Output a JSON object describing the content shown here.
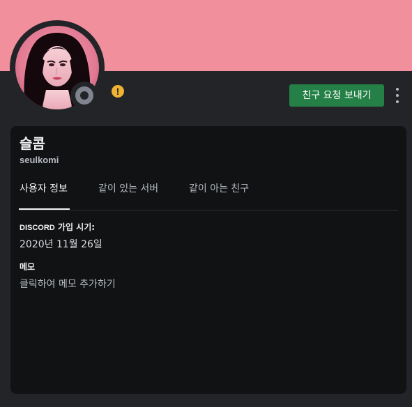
{
  "profile": {
    "display_name": "슬콤",
    "username": "seulkomi",
    "banner_color": "#f28f9c",
    "status": "offline",
    "warning_badge_glyph": "!"
  },
  "actions": {
    "send_friend_request_label": "친구 요청 보내기",
    "more_options_icon": "vertical-ellipsis-icon"
  },
  "tabs": [
    {
      "label": "사용자 정보",
      "active": true
    },
    {
      "label": "같이 있는 서버",
      "active": false
    },
    {
      "label": "같이 아는 친구",
      "active": false
    }
  ],
  "info": {
    "joined_label_prefix": "DISCORD",
    "joined_label_suffix": "가입 시기:",
    "joined_date": "2020년 11월 26일",
    "note_label": "메모",
    "note_placeholder": "클릭하여 메모 추가하기"
  },
  "colors": {
    "accent_green": "#248046",
    "warning_yellow": "#f0b232",
    "offline_gray": "#80848e"
  }
}
